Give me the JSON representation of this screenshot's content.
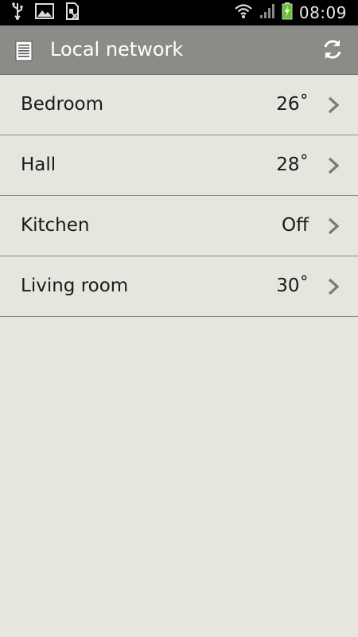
{
  "status_bar": {
    "time": "08:09",
    "left_icons": [
      "usb-icon",
      "image-icon",
      "sim-icon"
    ],
    "right_icons": [
      "wifi-icon",
      "signal-icon",
      "battery-charging-icon"
    ]
  },
  "action_bar": {
    "title": "Local network",
    "icon": "list-document-icon",
    "refresh_icon": "refresh-icon"
  },
  "rooms": [
    {
      "label": "Bedroom",
      "value": "26˚"
    },
    {
      "label": "Hall",
      "value": "28˚"
    },
    {
      "label": "Kitchen",
      "value": "Off"
    },
    {
      "label": "Living room",
      "value": "30˚"
    }
  ],
  "colors": {
    "background": "#e6e6df",
    "action_bar": "#8b8b87",
    "status_bar": "#000000",
    "divider": "#8d8d89",
    "battery_charging": "#66c22d"
  }
}
